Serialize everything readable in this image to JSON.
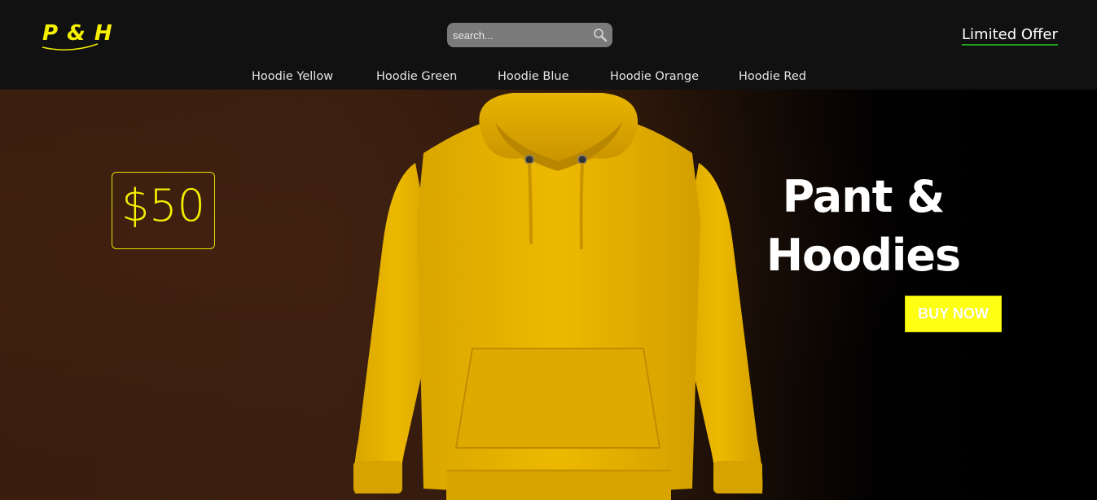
{
  "header": {
    "logo_text": "P & H",
    "search": {
      "placeholder": "search..."
    },
    "offer_label": "Limited Offer",
    "nav": [
      {
        "label": "Hoodie Yellow"
      },
      {
        "label": "Hoodie Green"
      },
      {
        "label": "Hoodie Blue"
      },
      {
        "label": "Hoodie Orange"
      },
      {
        "label": "Hoodie Red"
      }
    ]
  },
  "hero": {
    "price": "$50",
    "headline_line1": "Pant &",
    "headline_line2": "Hoodies",
    "cta_label": "BUY NOW",
    "product_image": "yellow-hoodie"
  },
  "colors": {
    "brand_yellow": "#f5f000",
    "offer_underline": "#1fa31f",
    "button_yellow": "#ffff14",
    "hoodie_yellow": "#e8b400"
  },
  "icons": {
    "search": "search-icon"
  }
}
